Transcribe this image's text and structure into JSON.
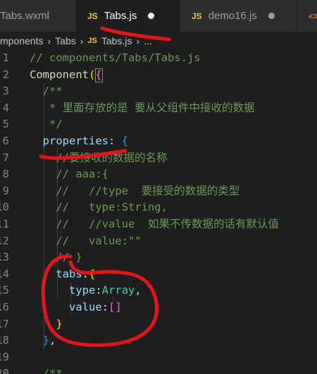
{
  "tabs": [
    {
      "label": "Tabs.wxml",
      "icon": "",
      "modified": false,
      "active": false
    },
    {
      "label": "Tabs.js",
      "icon": "JS",
      "modified": true,
      "active": true
    },
    {
      "label": "demo16.js",
      "icon": "JS",
      "modified": true,
      "active": false
    },
    {
      "label": "",
      "icon": "<>",
      "modified": false,
      "active": false
    }
  ],
  "breadcrumb": {
    "seg1": "mponents",
    "seg2": "Tabs",
    "file_icon": "JS",
    "file": "Tabs.js",
    "more": "..."
  },
  "lines": [
    {
      "num": "1",
      "tokens": [
        {
          "t": "// components/Tabs/Tabs.js",
          "c": "comment"
        }
      ]
    },
    {
      "num": "2",
      "tokens": [
        {
          "t": "Component",
          "c": "fn"
        },
        {
          "t": "(",
          "c": "paren-gold"
        },
        {
          "t": "{",
          "c": "paren"
        }
      ]
    },
    {
      "num": "3",
      "tokens": [
        {
          "t": "  /**",
          "c": "comment"
        }
      ]
    },
    {
      "num": "4",
      "tokens": [
        {
          "t": "   * 里面存放的是 要从父组件中接收的数据",
          "c": "comment"
        }
      ]
    },
    {
      "num": "5",
      "tokens": [
        {
          "t": "   */",
          "c": "comment"
        }
      ]
    },
    {
      "num": "6",
      "tokens": [
        {
          "t": "  ",
          "c": "plain"
        },
        {
          "t": "properties",
          "c": "prop"
        },
        {
          "t": ": ",
          "c": "plain"
        },
        {
          "t": "{",
          "c": "bracket"
        }
      ]
    },
    {
      "num": "7",
      "tokens": [
        {
          "t": "    //要接收的数据的名称",
          "c": "comment"
        }
      ]
    },
    {
      "num": "8",
      "tokens": [
        {
          "t": "    // aaa:{",
          "c": "comment"
        }
      ]
    },
    {
      "num": "9",
      "tokens": [
        {
          "t": "    //   //type  要接受的数据的类型",
          "c": "comment"
        }
      ]
    },
    {
      "num": "10",
      "tokens": [
        {
          "t": "    //   type:String,",
          "c": "comment"
        }
      ]
    },
    {
      "num": "11",
      "tokens": [
        {
          "t": "    //   //value  如果不传数据的话有默认值",
          "c": "comment"
        }
      ]
    },
    {
      "num": "12",
      "tokens": [
        {
          "t": "    //   value:\"\"",
          "c": "comment"
        }
      ]
    },
    {
      "num": "13",
      "tokens": [
        {
          "t": "    // }",
          "c": "comment"
        }
      ]
    },
    {
      "num": "14",
      "tokens": [
        {
          "t": "    ",
          "c": "plain"
        },
        {
          "t": "tabs",
          "c": "prop"
        },
        {
          "t": ":",
          "c": "plain"
        },
        {
          "t": "{",
          "c": "brace"
        }
      ]
    },
    {
      "num": "15",
      "tokens": [
        {
          "t": "      ",
          "c": "plain"
        },
        {
          "t": "type",
          "c": "prop"
        },
        {
          "t": ":",
          "c": "plain"
        },
        {
          "t": "Array",
          "c": "type"
        },
        {
          "t": ",",
          "c": "plain"
        }
      ]
    },
    {
      "num": "16",
      "tokens": [
        {
          "t": "      ",
          "c": "plain"
        },
        {
          "t": "value",
          "c": "prop"
        },
        {
          "t": ":",
          "c": "plain"
        },
        {
          "t": "[]",
          "c": "paren"
        }
      ]
    },
    {
      "num": "17",
      "tokens": [
        {
          "t": "    ",
          "c": "plain"
        },
        {
          "t": "}",
          "c": "brace"
        }
      ]
    },
    {
      "num": "18",
      "tokens": [
        {
          "t": "  ",
          "c": "plain"
        },
        {
          "t": "}",
          "c": "bracket"
        },
        {
          "t": ",",
          "c": "plain"
        }
      ]
    },
    {
      "num": "19",
      "tokens": []
    },
    {
      "num": "20",
      "tokens": [
        {
          "t": "  /**",
          "c": "comment"
        }
      ]
    }
  ],
  "colors": {
    "editor_bg": "#1e1e1e",
    "annotation": "#e0161b"
  }
}
